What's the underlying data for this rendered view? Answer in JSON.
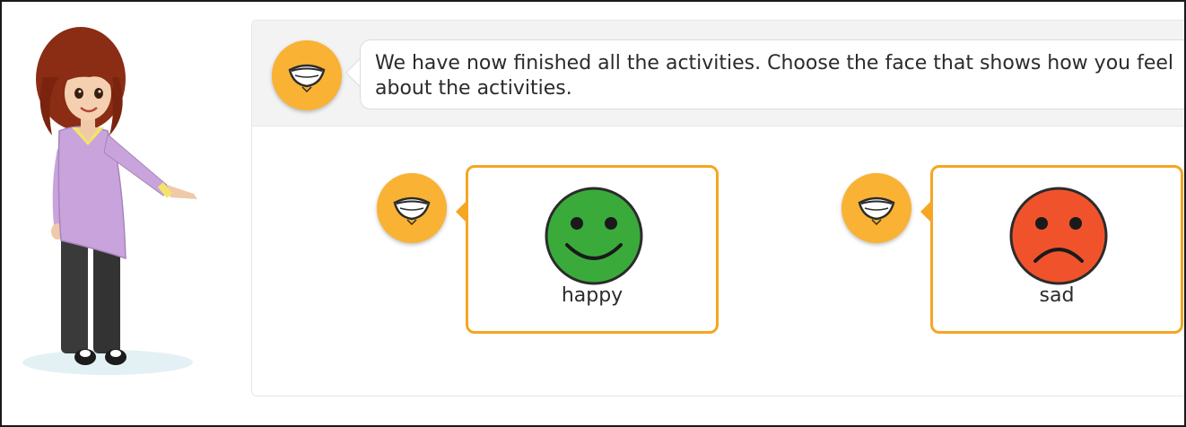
{
  "prompt": {
    "text": "We have now finished all the activities. Choose the face that shows how you feel about the activities."
  },
  "options": [
    {
      "label": "happy",
      "face_color": "#3aab3a",
      "icon": "smiley-face-icon"
    },
    {
      "label": "sad",
      "face_color": "#f0532c",
      "icon": "sad-face-icon"
    }
  ],
  "colors": {
    "speak_button": "#f9b233",
    "card_border": "#f5a623",
    "header_bg": "#f3f3f3"
  },
  "icons": {
    "speak": "speaking-mouth-icon",
    "character": "girl-pointing-illustration"
  }
}
